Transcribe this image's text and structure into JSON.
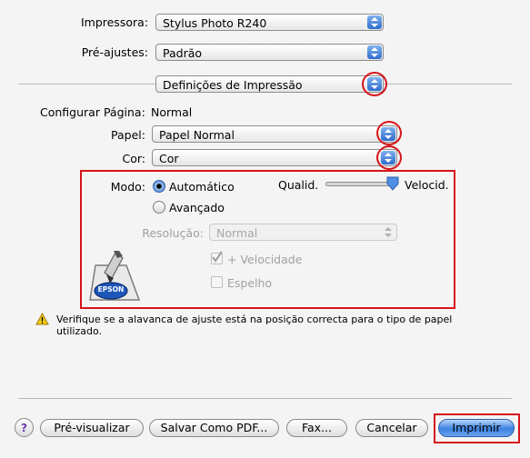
{
  "printer": {
    "label": "Impressora:",
    "value": "Stylus Photo R240"
  },
  "presets": {
    "label": "Pré-ajustes:",
    "value": "Padrão"
  },
  "section_popup": {
    "value": "Definições de Impressão"
  },
  "page_setup": {
    "label": "Configurar Página:",
    "value": "Normal"
  },
  "paper": {
    "label": "Papel:",
    "value": "Papel Normal"
  },
  "color": {
    "label": "Cor:",
    "value": "Cor"
  },
  "mode": {
    "label": "Modo:",
    "automatic": "Automático",
    "advanced": "Avançado",
    "selected": "Automático"
  },
  "quality_slider": {
    "left_label": "Qualid.",
    "right_label": "Velocid.",
    "level": 1.0
  },
  "resolution": {
    "label": "Resolução:",
    "value": "Normal"
  },
  "high_speed": {
    "label": "+ Velocidade",
    "checked": true
  },
  "mirror": {
    "label": "Espelho",
    "checked": false
  },
  "logo_text": "EPSON",
  "warning": {
    "text": "Verifique se a alavanca de ajuste está na posição correcta para o tipo de papel utilizado."
  },
  "buttons": {
    "help": "?",
    "preview": "Pré-visualizar",
    "save_pdf": "Salvar Como PDF...",
    "fax": "Fax...",
    "cancel": "Cancelar",
    "print": "Imprimir"
  },
  "colors": {
    "annotation_red": "#d7141a",
    "accent_blue": "#3b82e0"
  }
}
